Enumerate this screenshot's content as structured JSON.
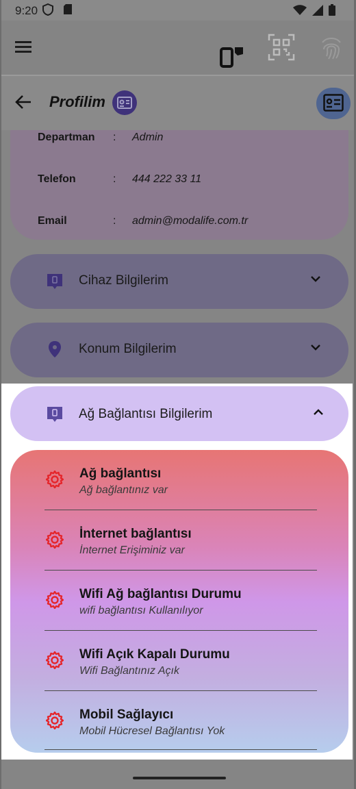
{
  "status_bar": {
    "time": "9:20",
    "left_icons": [
      "shield-icon",
      "sd-card-icon"
    ],
    "right_icons": [
      "wifi-icon",
      "signal-icon",
      "battery-icon"
    ]
  },
  "app_bar": {
    "icons": [
      "menu-icon",
      "device-icon",
      "qr-code-icon",
      "fingerprint-icon"
    ]
  },
  "title_bar": {
    "title": "Profilim",
    "icons": [
      "back-arrow-icon",
      "id-card-icon",
      "id-card-button-icon"
    ]
  },
  "profile_info": [
    {
      "label": "Departman",
      "colon": ":",
      "value": "Admin"
    },
    {
      "label": "Telefon",
      "colon": ":",
      "value": "444 222 33 11"
    },
    {
      "label": "Email",
      "colon": ":",
      "value": "admin@modalife.com.tr"
    }
  ],
  "sections": {
    "device": {
      "label": "Cihaz Bilgilerim",
      "icon": "device-tag-icon",
      "expanded": false
    },
    "location": {
      "label": "Konum Bilgilerim",
      "icon": "location-pin-icon",
      "expanded": false
    },
    "network": {
      "label": "Ağ Bağlantısı Bilgilerim",
      "icon": "device-tag-icon",
      "expanded": true
    }
  },
  "network_items": [
    {
      "title": "Ağ bağlantısı",
      "subtitle": "Ağ bağlantınız var"
    },
    {
      "title": "İnternet bağlantısı",
      "subtitle": "İnternet Erişiminiz var"
    },
    {
      "title": "Wifi Ağ bağlantısı Durumu",
      "subtitle": "wifi bağlantısı Kullanılıyor"
    },
    {
      "title": "Wifi Açık Kapalı Durumu",
      "subtitle": "Wifi Bağlantınız Açık"
    },
    {
      "title": "Mobil Sağlayıcı",
      "subtitle": "Mobil Hücresel Bağlantısı Yok"
    }
  ],
  "colors": {
    "accent_purple": "#d3c1f3",
    "gear_red": "#e5252a",
    "icon_purple": "#5a4aa0"
  }
}
